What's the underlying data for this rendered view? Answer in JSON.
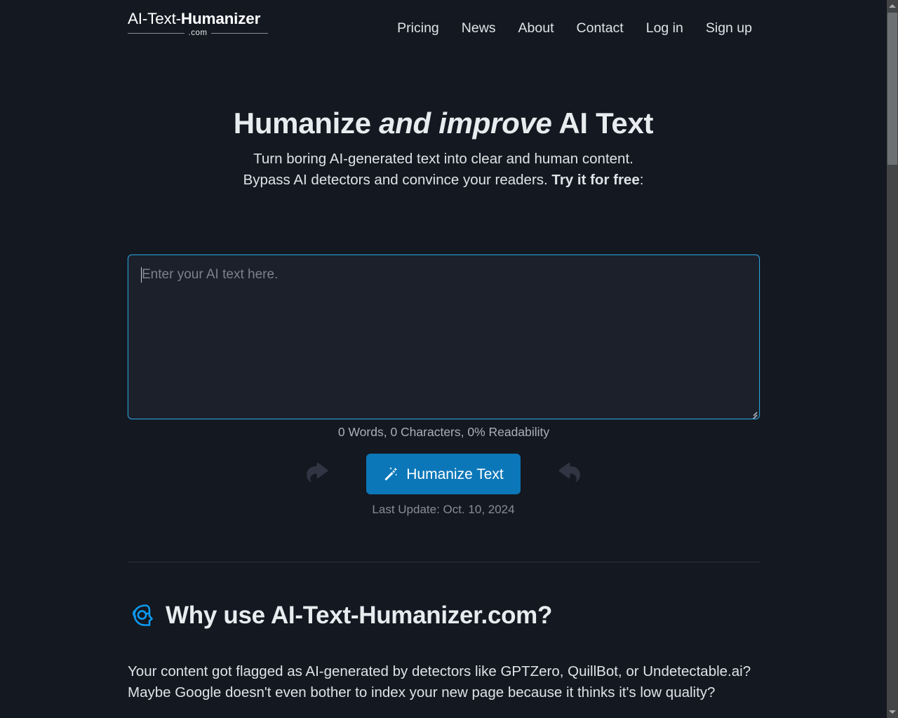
{
  "site": {
    "logo_light": "AI-Text-",
    "logo_bold": "Humanizer",
    "logo_domain": ".com"
  },
  "nav": {
    "items": [
      {
        "label": "Pricing"
      },
      {
        "label": "News"
      },
      {
        "label": "About"
      },
      {
        "label": "Contact"
      },
      {
        "label": "Log in"
      },
      {
        "label": "Sign up"
      }
    ]
  },
  "hero": {
    "title_part1": "Humanize ",
    "title_emphasis": "and improve",
    "title_part2": " AI Text",
    "subtitle_line1": "Turn boring AI-generated text into clear and human",
    "subtitle_line2": "content. Bypass AI detectors and convince your readers.",
    "cta_strong": "Try it for free",
    "cta_colon": ":"
  },
  "editor": {
    "placeholder": "Enter your AI text here.",
    "value": "",
    "stats": "0 Words, 0 Characters, 0% Readability",
    "words": 0,
    "characters": 0,
    "readability_percent": 0
  },
  "action": {
    "button_label": "Humanize Text",
    "button_icon": "magic-wand-icon",
    "left_hint_icon": "curved-arrow-right-icon",
    "right_hint_icon": "curved-arrow-left-icon",
    "last_update": "Last Update: Oct. 10, 2024"
  },
  "why": {
    "icon": "robot-head-icon",
    "heading": "Why use AI-Text-Humanizer.com?",
    "paragraph": "Your content got flagged as AI-generated by detectors like GPTZero, QuillBot, or Undetectable.ai? Maybe Google doesn't even bother to index your new page because it thinks it's low quality?"
  },
  "scrollbar": {
    "up_icon": "scroll-up-arrow-icon",
    "down_icon": "scroll-down-arrow-icon"
  },
  "colors": {
    "background": "#141820",
    "accent_blue": "#0b77b8",
    "focus_border": "#2a9fd6",
    "icon_blue": "#0d9bf0",
    "text_primary": "#e9ecef",
    "text_muted": "#868d97"
  }
}
